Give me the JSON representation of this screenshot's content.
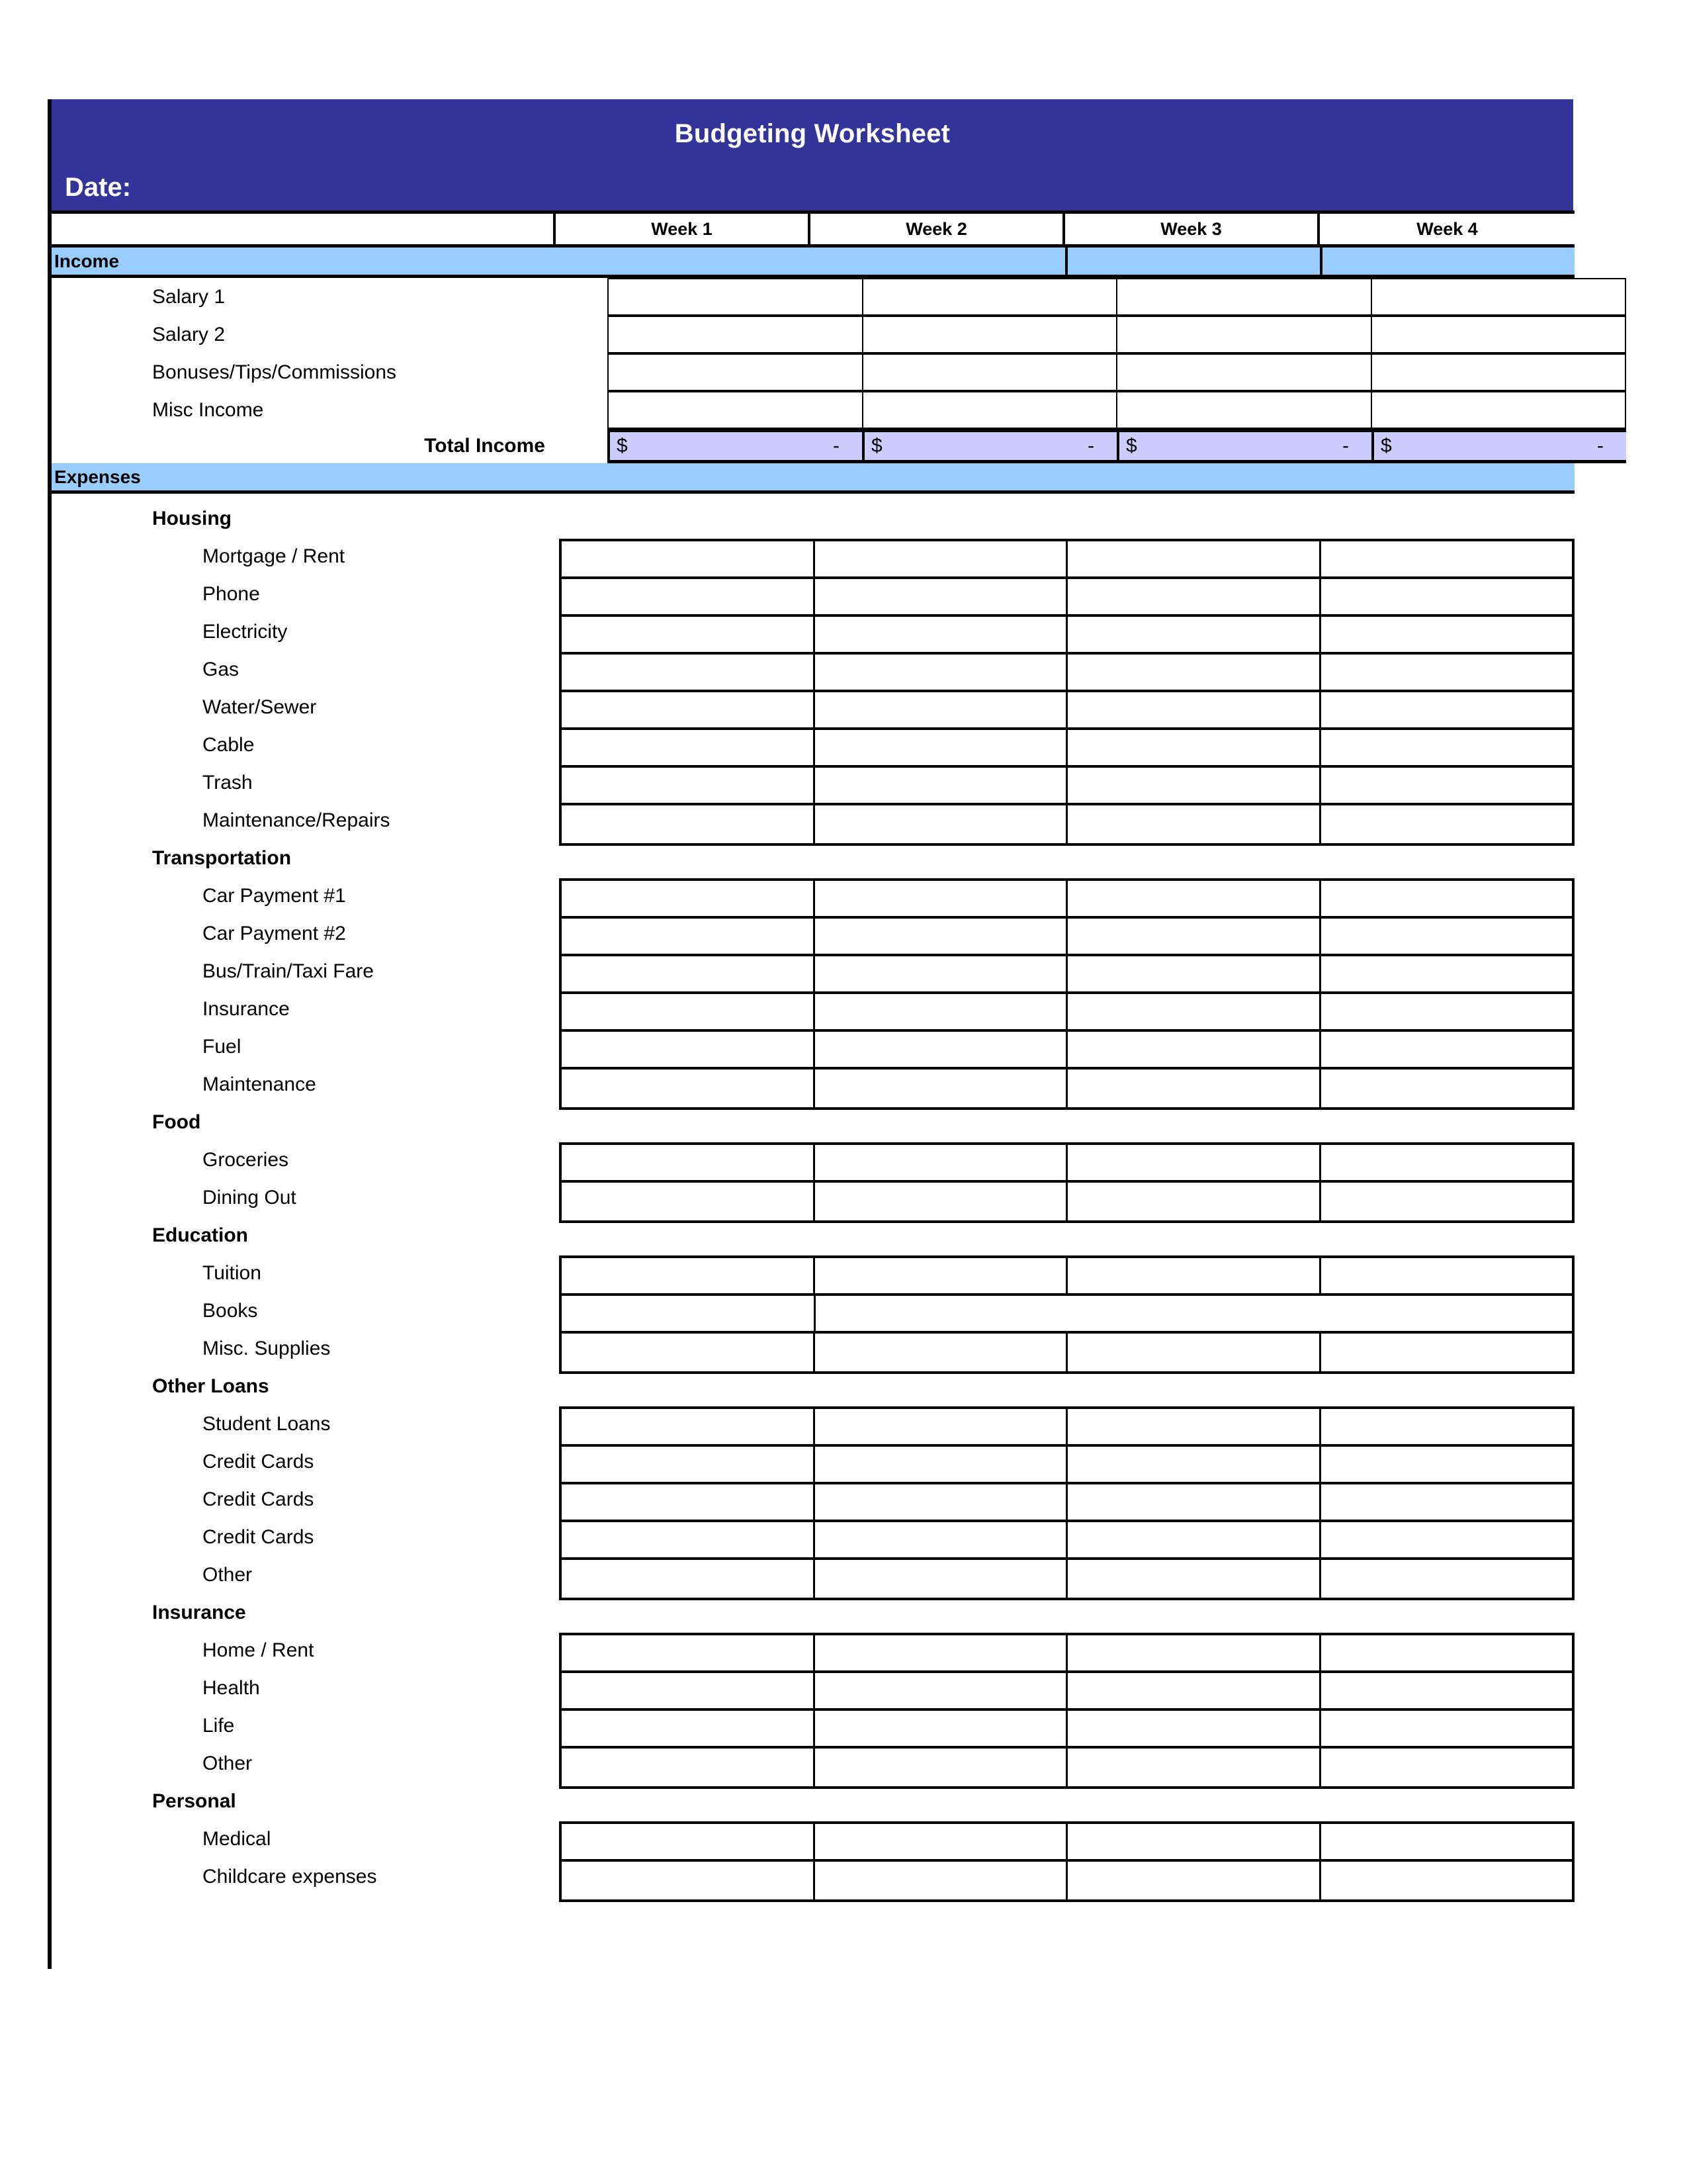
{
  "header": {
    "title": "Budgeting Worksheet",
    "date_label": "Date:"
  },
  "columns": {
    "label_header": "",
    "weeks": [
      "Week 1",
      "Week 2",
      "Week 3",
      "Week 4"
    ]
  },
  "colors": {
    "header_blue": "#333399",
    "section_blue": "#99CCFF",
    "total_lavender": "#CCCCFF",
    "grid_black": "#000000",
    "page_white": "#FFFFFF"
  },
  "income": {
    "section_label": "Income",
    "items": [
      {
        "label": "Salary 1",
        "values": [
          "",
          "",
          "",
          ""
        ]
      },
      {
        "label": "Salary 2",
        "values": [
          "",
          "",
          "",
          ""
        ]
      },
      {
        "label": "Bonuses/Tips/Commissions",
        "values": [
          "",
          "",
          "",
          ""
        ]
      },
      {
        "label": "Misc Income",
        "values": [
          "",
          "",
          "",
          ""
        ]
      }
    ],
    "total": {
      "label": "Total Income",
      "cells": [
        {
          "currency": "$",
          "amount": "-"
        },
        {
          "currency": "$",
          "amount": "-"
        },
        {
          "currency": "$",
          "amount": "-"
        },
        {
          "currency": "$",
          "amount": "-"
        }
      ]
    }
  },
  "expenses": {
    "section_label": "Expenses",
    "groups": [
      {
        "name": "Housing",
        "items": [
          {
            "label": "Mortgage / Rent",
            "values": [
              "",
              "",
              "",
              ""
            ]
          },
          {
            "label": "Phone",
            "values": [
              "",
              "",
              "",
              ""
            ]
          },
          {
            "label": "Electricity",
            "values": [
              "",
              "",
              "",
              ""
            ]
          },
          {
            "label": "Gas",
            "values": [
              "",
              "",
              "",
              ""
            ]
          },
          {
            "label": "Water/Sewer",
            "values": [
              "",
              "",
              "",
              ""
            ]
          },
          {
            "label": "Cable",
            "values": [
              "",
              "",
              "",
              ""
            ]
          },
          {
            "label": "Trash",
            "values": [
              "",
              "",
              "",
              ""
            ]
          },
          {
            "label": "Maintenance/Repairs",
            "values": [
              "",
              "",
              "",
              ""
            ]
          }
        ]
      },
      {
        "name": "Transportation",
        "items": [
          {
            "label": "Car Payment #1",
            "values": [
              "",
              "",
              "",
              ""
            ]
          },
          {
            "label": "Car Payment #2",
            "values": [
              "",
              "",
              "",
              ""
            ]
          },
          {
            "label": "Bus/Train/Taxi Fare",
            "values": [
              "",
              "",
              "",
              ""
            ]
          },
          {
            "label": "Insurance",
            "values": [
              "",
              "",
              "",
              ""
            ]
          },
          {
            "label": "Fuel",
            "values": [
              "",
              "",
              "",
              ""
            ]
          },
          {
            "label": "Maintenance",
            "values": [
              "",
              "",
              "",
              ""
            ]
          }
        ]
      },
      {
        "name": "Food",
        "items": [
          {
            "label": "Groceries",
            "values": [
              "",
              "",
              "",
              ""
            ]
          },
          {
            "label": "Dining Out",
            "values": [
              "",
              "",
              "",
              ""
            ]
          }
        ]
      },
      {
        "name": "Education",
        "items": [
          {
            "label": "Tuition",
            "values": [
              "",
              "",
              "",
              ""
            ]
          },
          {
            "label": "Books",
            "values": [
              "",
              ""
            ],
            "merged_tail": true
          },
          {
            "label": "Misc. Supplies",
            "values": [
              "",
              "",
              "",
              ""
            ]
          }
        ]
      },
      {
        "name": "Other Loans",
        "items": [
          {
            "label": "Student Loans",
            "values": [
              "",
              "",
              "",
              ""
            ]
          },
          {
            "label": "Credit Cards",
            "values": [
              "",
              "",
              "",
              ""
            ]
          },
          {
            "label": "Credit Cards",
            "values": [
              "",
              "",
              "",
              ""
            ]
          },
          {
            "label": "Credit Cards",
            "values": [
              "",
              "",
              "",
              ""
            ]
          },
          {
            "label": "Other",
            "values": [
              "",
              "",
              "",
              ""
            ]
          }
        ]
      },
      {
        "name": "Insurance",
        "items": [
          {
            "label": "Home / Rent",
            "values": [
              "",
              "",
              "",
              ""
            ]
          },
          {
            "label": "Health",
            "values": [
              "",
              "",
              "",
              ""
            ]
          },
          {
            "label": "Life",
            "values": [
              "",
              "",
              "",
              ""
            ]
          },
          {
            "label": "Other",
            "values": [
              "",
              "",
              "",
              ""
            ]
          }
        ]
      },
      {
        "name": "Personal",
        "items": [
          {
            "label": "Medical",
            "values": [
              "",
              "",
              "",
              ""
            ]
          },
          {
            "label": "Childcare expenses",
            "values": [
              "",
              "",
              "",
              ""
            ]
          }
        ]
      }
    ]
  }
}
